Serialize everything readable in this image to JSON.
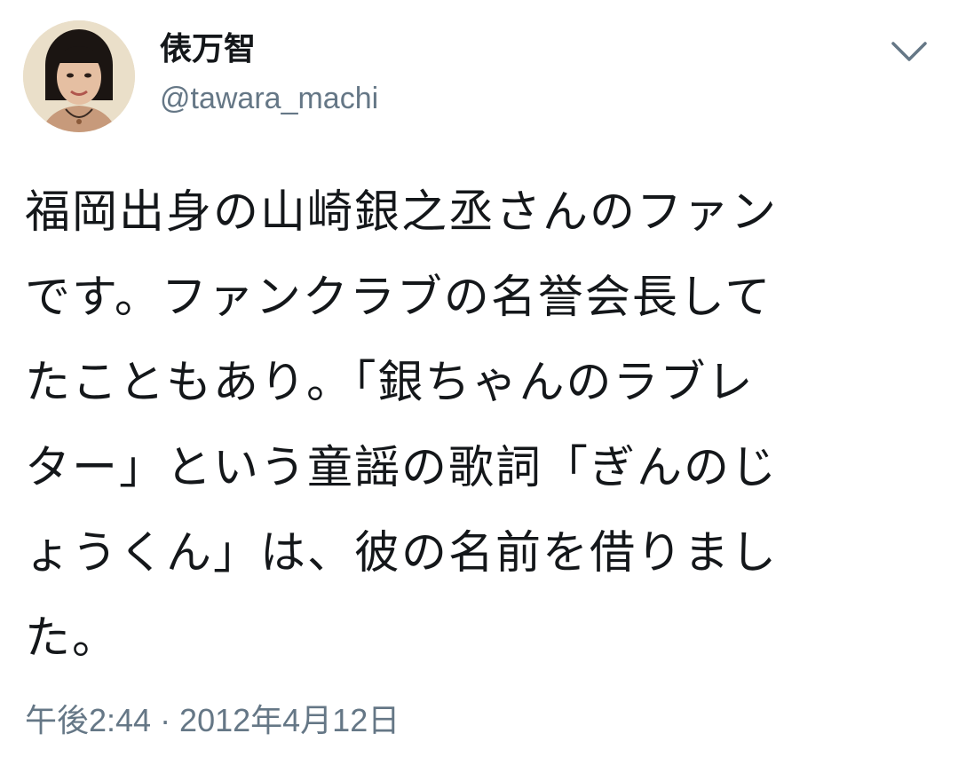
{
  "user": {
    "display_name": "俵万智",
    "handle": "@tawara_machi",
    "avatar_icon": "profile-photo"
  },
  "tweet": {
    "lines": [
      "福岡出身の山崎銀之丞さんのファン",
      "です。ファンクラブの名誉会長して",
      "たこともあり。「銀ちゃんのラブレ",
      "ター」という童謡の歌詞「ぎんのじ",
      "ょうくん」は、彼の名前を借りまし",
      "た。"
    ],
    "timestamp": "午後2:44 · 2012年4月12日"
  },
  "icons": {
    "menu": "chevron-down-icon"
  },
  "colors": {
    "text": "#14171a",
    "secondary": "#657786",
    "background": "#ffffff"
  }
}
